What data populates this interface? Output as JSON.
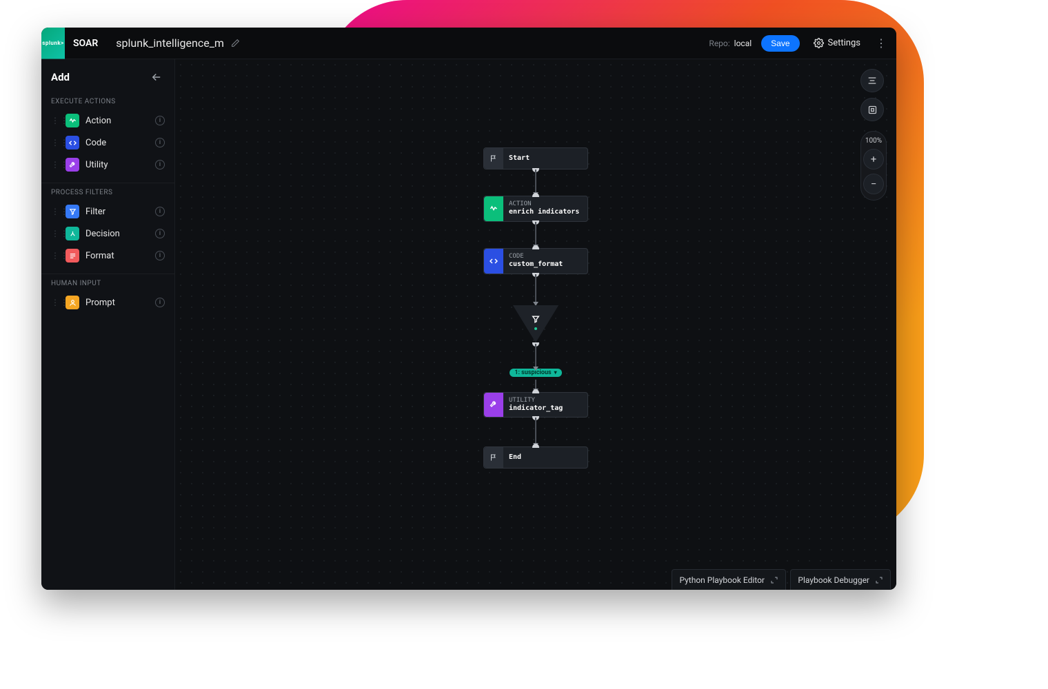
{
  "header": {
    "product": "SOAR",
    "logo_text": "splunk>",
    "playbook_name": "splunk_intelligence_m",
    "repo_label": "Repo:",
    "repo_value": "local",
    "save_label": "Save",
    "settings_label": "Settings"
  },
  "sidebar": {
    "title": "Add",
    "sections": [
      {
        "title": "EXECUTE ACTIONS",
        "items": [
          {
            "label": "Action",
            "icon": "action-icon",
            "color": "green"
          },
          {
            "label": "Code",
            "icon": "code-icon",
            "color": "blue"
          },
          {
            "label": "Utility",
            "icon": "utility-icon",
            "color": "purple"
          }
        ]
      },
      {
        "title": "PROCESS FILTERS",
        "items": [
          {
            "label": "Filter",
            "icon": "filter-icon",
            "color": "lblue"
          },
          {
            "label": "Decision",
            "icon": "decision-icon",
            "color": "teal"
          },
          {
            "label": "Format",
            "icon": "format-icon",
            "color": "red"
          }
        ]
      },
      {
        "title": "HUMAN INPUT",
        "items": [
          {
            "label": "Prompt",
            "icon": "prompt-icon",
            "color": "amber"
          }
        ]
      }
    ]
  },
  "canvas": {
    "zoom": "100%",
    "decision_path_label": "1: suspicious",
    "nodes": {
      "start": {
        "label": "Start"
      },
      "action": {
        "type": "ACTION",
        "label": "enrich indicators"
      },
      "code": {
        "type": "CODE",
        "label": "custom_format"
      },
      "utility": {
        "type": "UTILITY",
        "label": "indicator_tag"
      },
      "end": {
        "label": "End"
      }
    }
  },
  "footer": {
    "editor_tab": "Python Playbook Editor",
    "debugger_tab": "Playbook Debugger"
  }
}
